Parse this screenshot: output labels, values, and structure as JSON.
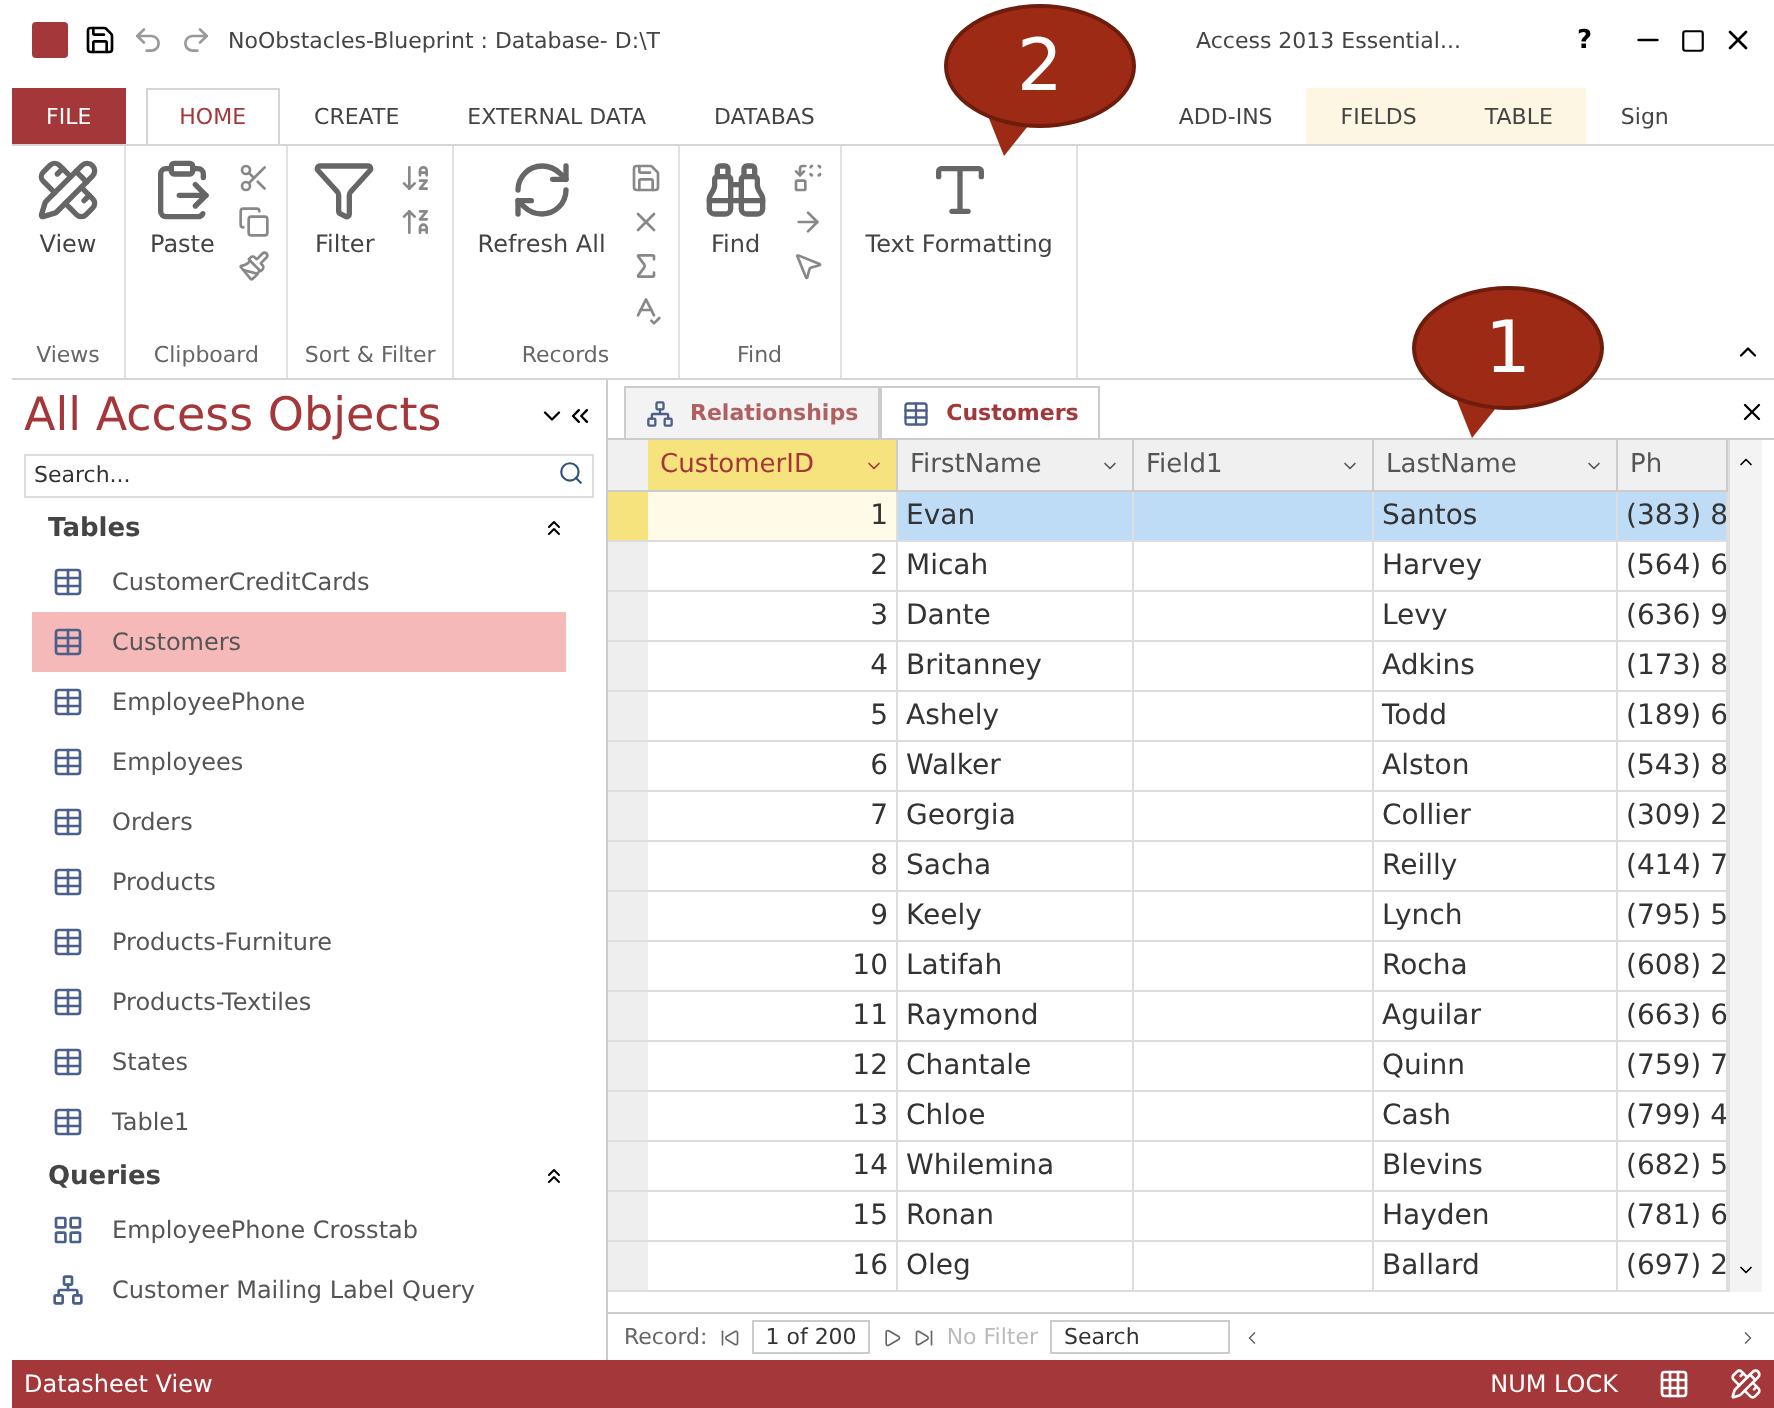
{
  "window": {
    "title_left": "NoObstacles-Blueprint : Database- D:\\T",
    "title_right": "Access 2013 Essential...",
    "help": "?"
  },
  "ribbon_tabs": [
    {
      "label": "FILE",
      "kind": "file",
      "selected": false
    },
    {
      "label": "HOME",
      "kind": "main",
      "selected": true
    },
    {
      "label": "CREATE",
      "kind": "main",
      "selected": false
    },
    {
      "label": "EXTERNAL DATA",
      "kind": "main",
      "selected": false
    },
    {
      "label": "DATABAS",
      "kind": "partial",
      "selected": false
    },
    {
      "label": "ADD-INS",
      "kind": "main",
      "selected": false
    },
    {
      "label": "FIELDS",
      "kind": "context",
      "selected": false
    },
    {
      "label": "TABLE",
      "kind": "context",
      "selected": false
    },
    {
      "label": "Sign",
      "kind": "sign",
      "selected": false
    }
  ],
  "ribbon_groups": [
    {
      "name": "Views",
      "button": "View"
    },
    {
      "name": "Clipboard",
      "button": "Paste"
    },
    {
      "name": "Sort & Filter",
      "button": "Filter"
    },
    {
      "name": "Records",
      "button": "Refresh All"
    },
    {
      "name": "Find",
      "button": "Find"
    },
    {
      "button": "Text Formatting"
    }
  ],
  "navigation_pane": {
    "title": "All Access Objects",
    "search": {
      "placeholder": "Search..."
    },
    "sections": [
      {
        "title": "Tables",
        "items": [
          {
            "label": "CustomerCreditCards",
            "kind": "table",
            "selected": false
          },
          {
            "label": "Customers",
            "kind": "table",
            "selected": true
          },
          {
            "label": "EmployeePhone",
            "kind": "table",
            "selected": false
          },
          {
            "label": "Employees",
            "kind": "table",
            "selected": false
          },
          {
            "label": "Orders",
            "kind": "table",
            "selected": false
          },
          {
            "label": "Products",
            "kind": "table",
            "selected": false
          },
          {
            "label": "Products-Furniture",
            "kind": "table",
            "selected": false
          },
          {
            "label": "Products-Textiles",
            "kind": "table",
            "selected": false
          },
          {
            "label": "States",
            "kind": "table",
            "selected": false
          },
          {
            "label": "Table1",
            "kind": "table",
            "selected": false
          }
        ]
      },
      {
        "title": "Queries",
        "items": [
          {
            "label": "EmployeePhone Crosstab",
            "kind": "crosstab",
            "selected": false
          },
          {
            "label": "Customer Mailing Label Query",
            "kind": "query",
            "selected": false
          }
        ]
      }
    ]
  },
  "document_tabs": [
    {
      "label": "Relationships",
      "kind": "relationships",
      "selected": false
    },
    {
      "label": "Customers",
      "kind": "table",
      "selected": true
    }
  ],
  "table": {
    "columns": [
      {
        "label": "CustomerID",
        "selected": true
      },
      {
        "label": "FirstName",
        "selected": false
      },
      {
        "label": "Field1",
        "selected": false
      },
      {
        "label": "LastName",
        "selected": false
      },
      {
        "label": "Ph",
        "selected": false
      }
    ],
    "rows": [
      {
        "id": "1",
        "first": "Evan",
        "last": "Santos",
        "phone": "(383) 8",
        "selected": true
      },
      {
        "id": "2",
        "first": "Micah",
        "last": "Harvey",
        "phone": "(564) 6",
        "selected": false
      },
      {
        "id": "3",
        "first": "Dante",
        "last": "Levy",
        "phone": "(636) 9",
        "selected": false
      },
      {
        "id": "4",
        "first": "Britanney",
        "last": "Adkins",
        "phone": "(173) 8",
        "selected": false
      },
      {
        "id": "5",
        "first": "Ashely",
        "last": "Todd",
        "phone": "(189) 6",
        "selected": false
      },
      {
        "id": "6",
        "first": "Walker",
        "last": "Alston",
        "phone": "(543) 8",
        "selected": false
      },
      {
        "id": "7",
        "first": "Georgia",
        "last": "Collier",
        "phone": "(309) 2",
        "selected": false
      },
      {
        "id": "8",
        "first": "Sacha",
        "last": "Reilly",
        "phone": "(414) 7",
        "selected": false
      },
      {
        "id": "9",
        "first": "Keely",
        "last": "Lynch",
        "phone": "(795) 5",
        "selected": false
      },
      {
        "id": "10",
        "first": "Latifah",
        "last": "Rocha",
        "phone": "(608) 2",
        "selected": false
      },
      {
        "id": "11",
        "first": "Raymond",
        "last": "Aguilar",
        "phone": "(663) 6",
        "selected": false
      },
      {
        "id": "12",
        "first": "Chantale",
        "last": "Quinn",
        "phone": "(759) 7",
        "selected": false
      },
      {
        "id": "13",
        "first": "Chloe",
        "last": "Cash",
        "phone": "(799) 4",
        "selected": false
      },
      {
        "id": "14",
        "first": "Whilemina",
        "last": "Blevins",
        "phone": "(682) 5",
        "selected": false
      },
      {
        "id": "15",
        "first": "Ronan",
        "last": "Hayden",
        "phone": "(781) 6",
        "selected": false
      },
      {
        "id": "16",
        "first": "Oleg",
        "last": "Ballard",
        "phone": "(697) 2",
        "selected": false
      }
    ]
  },
  "record_nav": {
    "label": "Record:",
    "position": "1 of 200",
    "filter": "No Filter",
    "search": "Search"
  },
  "status_bar": {
    "view": "Datasheet View",
    "indicator": "NUM LOCK"
  },
  "callouts": [
    {
      "label": "2"
    },
    {
      "label": "1"
    }
  ]
}
